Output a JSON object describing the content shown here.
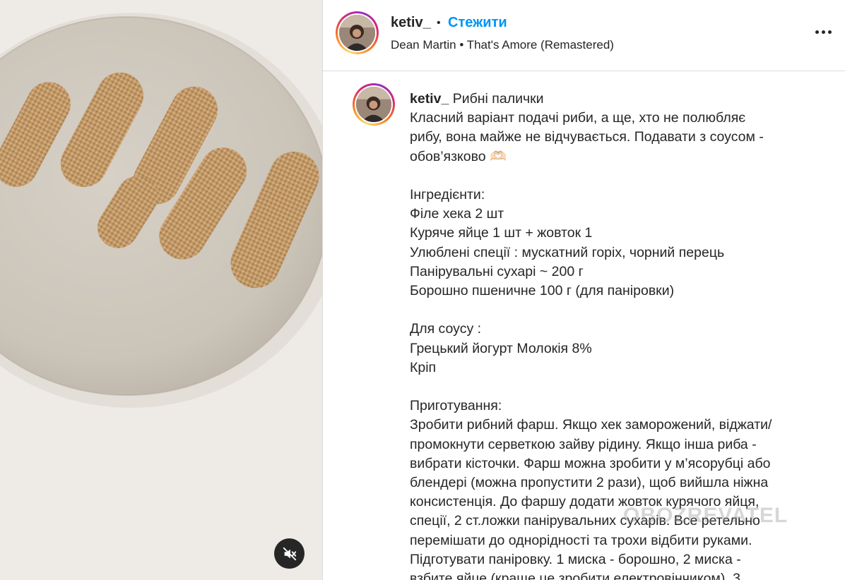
{
  "post": {
    "username": "ketiv_",
    "separator": "•",
    "follow_label": "Стежити",
    "music": "Dean Martin • That's Amore (Remastered)",
    "more_icon": "more-horizontal-icon"
  },
  "caption": {
    "username": "ketiv_",
    "title": "Рибні палички",
    "lines": [
      "Класний варіант подачі риби, а ще, хто не полюбляє",
      "рибу, вона майже не відчувається. Подавати з соусом -",
      "обов’язково 🫶🏻",
      "",
      "Інгредієнти:",
      "Філе хека 2 шт",
      "Куряче яйце 1 шт + жовток 1",
      "Улюблені спеції : мускатний горіх, чорний перець",
      "Панірувальні сухарі ~ 200 г",
      "Борошно пшеничне 100 г (для паніровки)",
      "",
      "Для соусу :",
      "Грецький йогурт Молокія 8%",
      "Кріп",
      "",
      "Приготування:",
      "Зробити рибний фарш. Якщо хек заморожений, віджати/",
      "промокнути серветкою зайву рідину. Якщо інша риба -",
      "вибрати кісточки. Фарш можна зробити у м’ясорубці або",
      "блендері (можна пропустити 2 рази), щоб вийшла ніжна",
      "консистенція. До фаршу додати жовток курячого яйця,",
      "спеції, 2 ст.ложки панірувальних сухарів. Все ретельно",
      "перемішати до однорідності та трохи відбити руками.",
      "Підготувати паніровку. 1 миска - борошно, 2 миска -",
      "взбите яйце (краще це зробити електровінчиком). 3"
    ]
  },
  "media": {
    "mute_icon": "volume-muted-icon"
  },
  "watermark": "OBOZREVATEL",
  "colors": {
    "accent": "#0095f6",
    "text": "#262626",
    "border": "#dbdbdb"
  }
}
